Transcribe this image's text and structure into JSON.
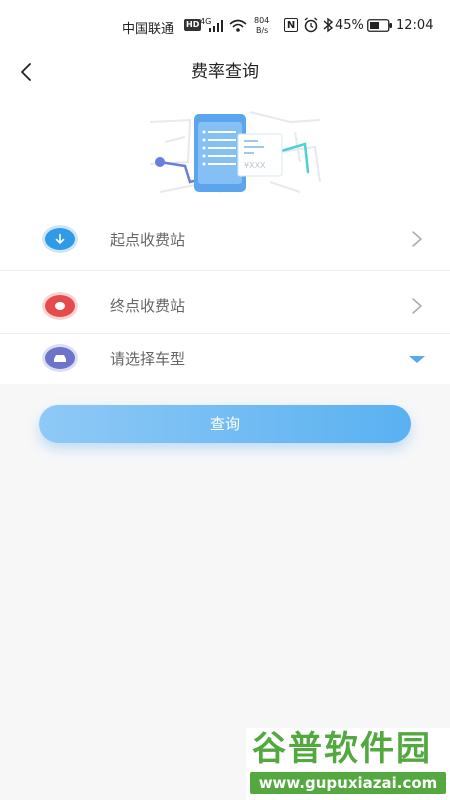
{
  "status_bar": {
    "carrier": "中国联通",
    "hd_badge": "HD",
    "network_type": "4G",
    "speed_value": "804",
    "speed_unit": "B/s",
    "nfc": "N",
    "battery_percent": "45%",
    "time": "12:04"
  },
  "header": {
    "title": "费率查询"
  },
  "hero": {
    "price_text": "¥XXX"
  },
  "form": {
    "rows": [
      {
        "label": "起点收费站",
        "icon": "arrow-down-icon",
        "color": "#2f9ae6",
        "control": "chevron-right-icon"
      },
      {
        "label": "终点收费站",
        "icon": "stop-circle-icon",
        "color": "#e64b4b",
        "control": "chevron-right-icon"
      },
      {
        "label": "请选择车型",
        "icon": "car-icon",
        "color": "#6b74c8",
        "control": "caret-down-icon"
      }
    ]
  },
  "actions": {
    "query_label": "查询"
  },
  "watermark": {
    "title": "谷普软件园",
    "url": "www.gupuxiazai.com"
  }
}
